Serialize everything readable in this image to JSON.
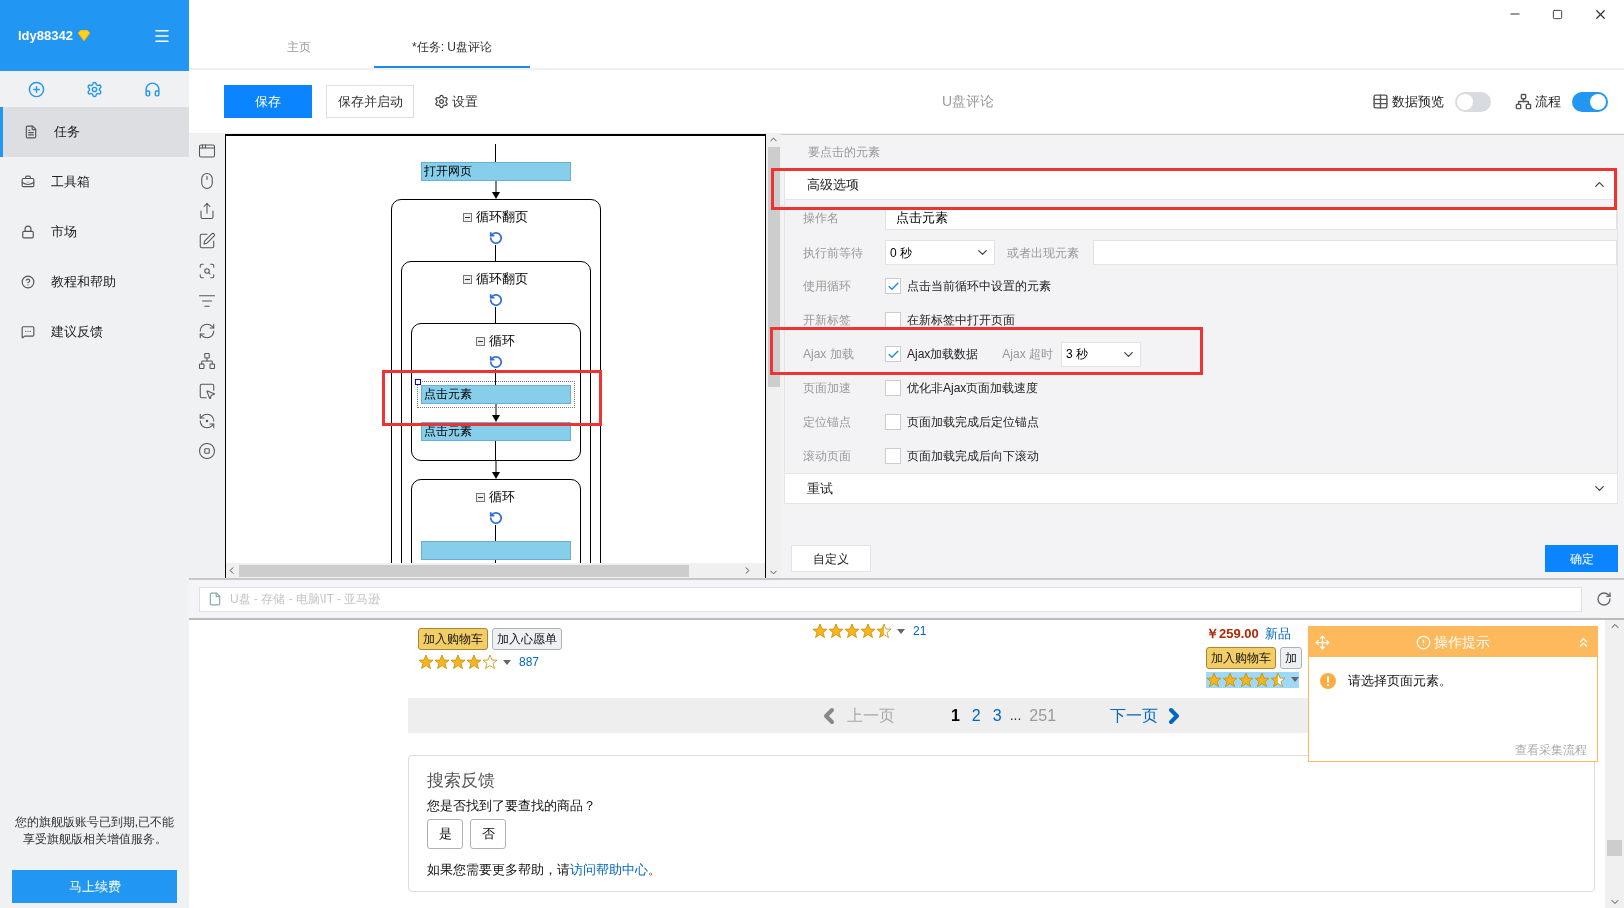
{
  "sidebar": {
    "user": "ldy88342",
    "items": [
      {
        "label": "任务",
        "selected": true
      },
      {
        "label": "工具箱",
        "selected": false
      },
      {
        "label": "市场",
        "selected": false
      },
      {
        "label": "教程和帮助",
        "selected": false
      },
      {
        "label": "建议反馈",
        "selected": false
      }
    ],
    "notice": "您的旗舰版账号已到期,已不能享受旗舰版相关增值服务。",
    "renew": "马上续费"
  },
  "tabs": [
    {
      "label": "主页",
      "selected": false
    },
    {
      "label": "*任务: U盘评论",
      "selected": true
    }
  ],
  "toolbar": {
    "save": "保存",
    "save_start": "保存并启动",
    "settings": "设置",
    "title": "U盘评论",
    "toggles": [
      {
        "label": "数据预览",
        "on": false
      },
      {
        "label": "流程",
        "on": true
      }
    ]
  },
  "workflow": {
    "nodes": [
      {
        "kind": "action",
        "label": "打开网页",
        "selected": false
      },
      {
        "kind": "loop",
        "label": "循环翻页",
        "children": [
          {
            "kind": "loop",
            "label": "循环翻页",
            "children": [
              {
                "kind": "loop",
                "label": "循环",
                "children": [
                  {
                    "kind": "action",
                    "label": "点击元素",
                    "selected": true
                  },
                  {
                    "kind": "action",
                    "label": "点击元素",
                    "selected": false
                  }
                ]
              },
              {
                "kind": "loop",
                "label": "循环",
                "children": [
                  {
                    "kind": "action",
                    "selected": false
                  }
                ]
              }
            ]
          }
        ]
      }
    ]
  },
  "properties": {
    "caption": "要点击的元素",
    "sections": [
      {
        "title": "高级选项",
        "expanded": true,
        "fields": [
          {
            "kind": "text",
            "label": "操作名",
            "value": "点击元素"
          },
          {
            "kind": "select",
            "label": "执行前等待",
            "value": "0 秒",
            "extra_label": "或者出现元素"
          },
          {
            "kind": "checkbox",
            "label": "使用循环",
            "option": "点击当前循环中设置的元素",
            "checked": true
          },
          {
            "kind": "checkbox",
            "label": "开新标签",
            "option": "在新标签中打开页面",
            "checked": false
          },
          {
            "kind": "checkbox",
            "label": "Ajax 加载",
            "option": "Ajax加载数据",
            "checked": true,
            "timeout_label": "Ajax 超时",
            "timeout": "3 秒"
          },
          {
            "kind": "checkbox",
            "label": "页面加速",
            "option": "优化非Ajax页面加载速度",
            "checked": false
          },
          {
            "kind": "checkbox",
            "label": "定位锚点",
            "option": "页面加载完成后定位锚点",
            "checked": false
          },
          {
            "kind": "checkbox",
            "label": "滚动页面",
            "option": "页面加载完成后向下滚动",
            "checked": false
          }
        ]
      },
      {
        "title": "重试",
        "expanded": false
      }
    ],
    "custom": "自定义",
    "confirm": "确定"
  },
  "browser": {
    "address": "U盘 - 存储 - 电脑\\IT - 亚马逊",
    "products": [
      {
        "buttons": [
          "加入购物车",
          "加入心愿单"
        ],
        "stars": 4,
        "reviews": "887"
      },
      {
        "stars": 4.5,
        "reviews": "21"
      },
      {
        "price": "￥259.00",
        "badge": "新品",
        "buttons": [
          "加入购物车",
          "加"
        ],
        "stars": 4.5
      }
    ],
    "pagination": {
      "prev": {
        "label": "上一页",
        "disabled": true
      },
      "pages": [
        {
          "label": "1",
          "selected": true
        },
        {
          "label": "2",
          "selected": false
        },
        {
          "label": "3",
          "selected": false
        }
      ],
      "ellipsis": "...",
      "last": "251",
      "next": {
        "label": "下一页",
        "disabled": false
      }
    },
    "feedback": {
      "title": "搜索反馈",
      "question": "您是否找到了要查找的商品？",
      "answers": [
        "是",
        "否"
      ],
      "help": "如果您需要更多帮助，请",
      "link": "访问帮助中心",
      "end": "。"
    }
  },
  "tip": {
    "title": "操作提示",
    "message": "请选择页面元素。",
    "link": "查看采集流程"
  }
}
